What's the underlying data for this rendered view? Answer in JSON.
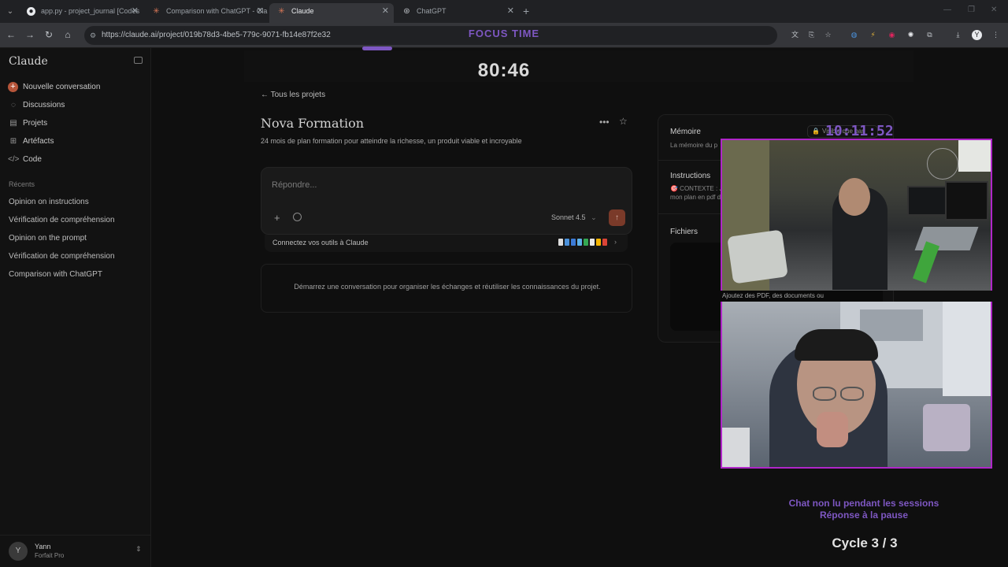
{
  "browser": {
    "tabs": [
      {
        "label": "app.py - project_journal [Codes",
        "icon": "github-icon",
        "active": false
      },
      {
        "label": "Comparison with ChatGPT - Cla",
        "icon": "claude-icon",
        "active": false
      },
      {
        "label": "Claude",
        "icon": "claude-icon",
        "active": true
      },
      {
        "label": "ChatGPT",
        "icon": "chatgpt-icon",
        "active": false
      }
    ],
    "url": "https://claude.ai/project/019b78d3-4be5-779c-9071-fb14e87f2e32",
    "profile_initial": "Y"
  },
  "overlay": {
    "focus_label": "FOCUS TIME",
    "timer": "80:46",
    "clock": "10:11:52",
    "chat_note_line1": "Chat non lu pendant les sessions",
    "chat_note_line2": "Réponse à la pause",
    "cycle": "Cycle 3 / 3"
  },
  "sidebar": {
    "brand": "Claude",
    "items": [
      {
        "label": "Nouvelle conversation",
        "icon": "plus-icon"
      },
      {
        "label": "Discussions",
        "icon": "chat-bubble-icon"
      },
      {
        "label": "Projets",
        "icon": "folder-icon"
      },
      {
        "label": "Artéfacts",
        "icon": "grid-icon"
      },
      {
        "label": "Code",
        "icon": "code-icon"
      }
    ],
    "recents_label": "Récents",
    "recents": [
      "Opinion on instructions",
      "Vérification de compréhension",
      "Opinion on the prompt",
      "Vérification de compréhension",
      "Comparison with ChatGPT"
    ],
    "user": {
      "initial": "Y",
      "name": "Yann",
      "plan": "Forfait Pro"
    }
  },
  "project": {
    "back_label": "Tous les projets",
    "title": "Nova Formation",
    "description": "24 mois de plan formation pour atteindre la richesse, un produit viable et incroyable",
    "composer_placeholder": "Répondre...",
    "model": "Sonnet 4.5",
    "connect_label": "Connectez vos outils à Claude",
    "empty_state": "Démarrez une conversation pour organiser les échanges et réutiliser les connaissances du projet."
  },
  "panel": {
    "memory_heading": "Mémoire",
    "memory_sub": "La mémoire du p",
    "visibility_badge": "Visible que par",
    "instructions_heading": "Instructions",
    "instructions_line1": "🎯 CONTEXTE : J",
    "instructions_line2": "mon plan en pdf d",
    "files_heading": "Fichiers",
    "files_hint": "Ajoutez des PDF, des documents ou"
  },
  "colors": {
    "accent_purple": "#7e57c2",
    "cam_border": "#b026c9",
    "send_button": "#7a3a29",
    "claude_orange": "#b6553a"
  }
}
